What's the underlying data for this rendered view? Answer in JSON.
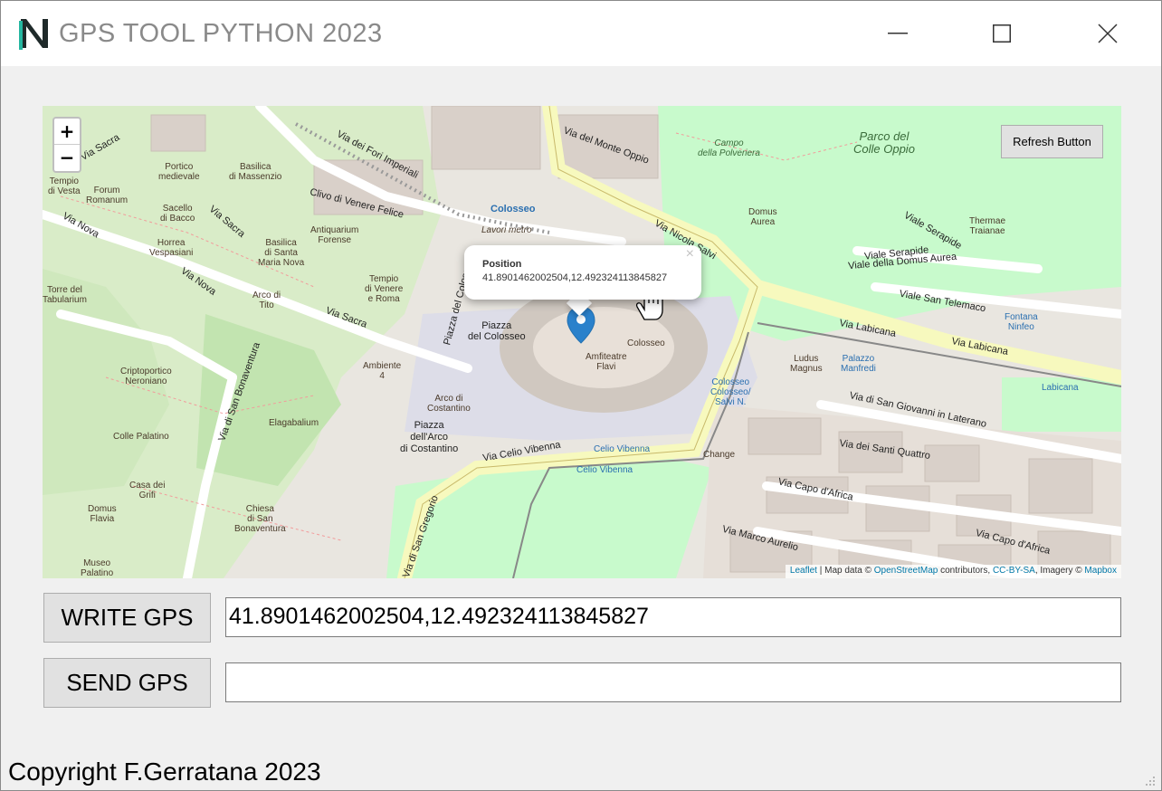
{
  "window": {
    "title": "GPS TOOL PYTHON 2023",
    "logo_letter": "N",
    "controls": [
      "minimize-icon",
      "maximize-icon",
      "close-icon"
    ]
  },
  "map": {
    "zoom_in": "+",
    "zoom_out": "−",
    "refresh_button": "Refresh Button",
    "popup": {
      "title": "Position",
      "coords": "41.8901462002504,12.492324113845827",
      "close": "×"
    },
    "attribution": {
      "leaflet": "Leaflet",
      "map_data": " | Map data © ",
      "osm": "OpenStreetMap",
      "contributors": " contributors, ",
      "license": "CC-BY-SA",
      "imagery": ", Imagery © ",
      "mapbox": "Mapbox"
    },
    "labels": {
      "parco": "Parco del\nColle Oppio",
      "colosseo_station": "Colosseo",
      "piazza_colosseo": "Piazza\ndel Colosseo",
      "anfiteatro": "Amfiteatre\nFlavi",
      "colosseo": "Colosseo",
      "arco_costantino": "Arco di\nCostantino",
      "piazza_arco": "Piazza\ndell'Arco\ndi Costantino",
      "via_celio": "Via Celio Vibenna",
      "via_labicana": "Via Labicana",
      "via_sacra": "Via Sacra",
      "via_nova": "Via Nova",
      "via_fori": "Via dei Fori Imperiali",
      "clivo": "Clivo di Venere Felice",
      "via_nicola": "Via Nicola Salvi",
      "viale_domus": "Viale della Domus Aurea",
      "viale_serapide": "Viale Serapide",
      "viale_telemaco": "Viale San Telemaco",
      "via_giovanni": "Via di San Giovanni in Laterano",
      "via_quattro": "Via dei Santi Quattro",
      "via_capo": "Via Capo d'Africa",
      "via_marco": "Via Marco Aurelio",
      "via_bonaventura": "Via di San Bonaventura",
      "via_gregorio": "Via di San Gregorio",
      "piazza_del_colosseo_rd": "Piazza del Colosseo",
      "via_monte": "Via del Monte Oppio",
      "basilica_massenzio": "Basilica\ndi Massenzio",
      "portico": "Portico\nmedievale",
      "forum": "Forum\nRomanum",
      "tempio_vesta": "Tempio\ndi Vesta",
      "sacello": "Sacello\ndi Bacco",
      "horrea": "Horrea\nVespasiani",
      "basilica_santa": "Basilica\ndi Santa\nMaria Nova",
      "antiquarium": "Antiquarium\nForense",
      "tempio_venere": "Tempio\ndi Venere\ne Roma",
      "arco_tito": "Arco di\nTito",
      "torre": "Torre del\nTabularium",
      "cripto": "Criptoportico\nNeroniano",
      "ambiente": "Ambiente\n4",
      "elagabalium": "Elagabalium",
      "colle_palatino": "Colle Palatino",
      "casa_grifi": "Casa dei\nGrifi",
      "domus_flavia": "Domus\nFlavia",
      "chiesa": "Chiesa\ndi San\nBonaventura",
      "museo": "Museo\nPalatino",
      "ludus": "Ludus\nMagnus",
      "palazzo": "Palazzo\nManfredi",
      "domus_aurea": "Domus\nAurea",
      "thermae": "Thermae\nTraianae",
      "campo": "Campo\ndella Polveriera",
      "fontana": "Fontana\nNinfeo",
      "celio_vibenna_stop": "Celio Vibenna",
      "colosseo_stop": "Colosseo\nColosseo/\nSalvi N.",
      "labicana_stop": "Labicana",
      "change": "Change",
      "lavori": "Lavori metro"
    }
  },
  "write_button": "WRITE GPS",
  "write_field_value": "41.8901462002504,12.492324113845827",
  "send_button": "SEND GPS",
  "send_field_value": "",
  "copyright": "Copyright F.Gerratana 2023",
  "colors": {
    "map_bg": "#e9e6e0",
    "park": "#c8facc",
    "road_major": "#f7f9be",
    "marker": "#2a81cb"
  }
}
